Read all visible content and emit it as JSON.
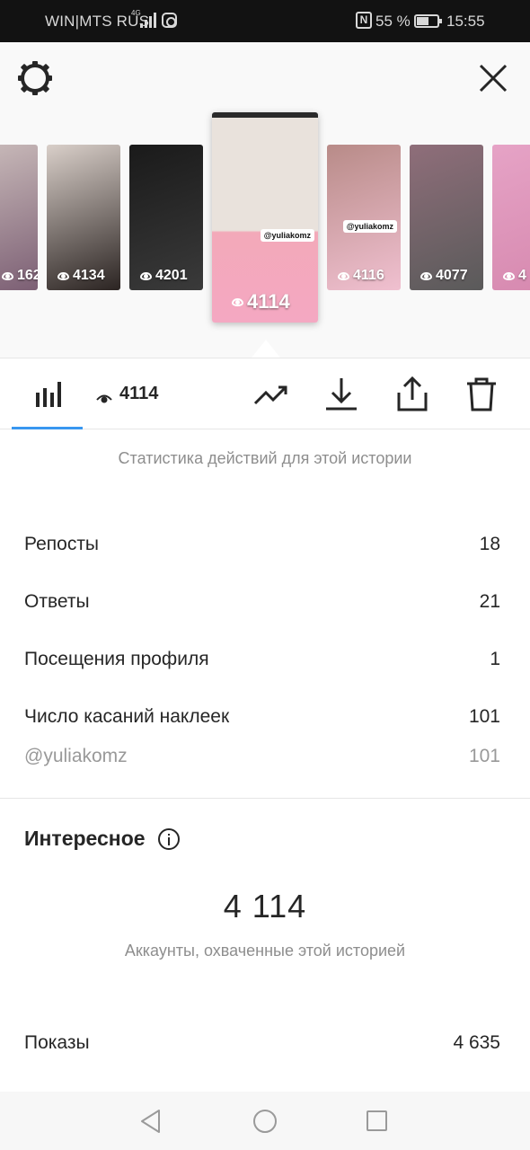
{
  "status_bar": {
    "carrier": "WIN|MTS RUS",
    "network": "4G",
    "battery_percent": "55 %",
    "time": "15:55"
  },
  "stories": [
    {
      "views": "162",
      "colors": [
        "#c7b8b8",
        "#7c5f74"
      ]
    },
    {
      "views": "4134",
      "colors": [
        "#d9cfc9",
        "#2b2422"
      ]
    },
    {
      "views": "4201",
      "colors": [
        "#1a1a1a",
        "#3a3a3a"
      ]
    },
    {
      "views": "4114",
      "tag": "@yuliakomz",
      "selected": true,
      "colors": [
        "#e9e2dc",
        "#f3a9b9",
        "#f4a8c2"
      ]
    },
    {
      "views": "4116",
      "tag": "@yuliakomz",
      "colors": [
        "#b88b88",
        "#f0c0d0"
      ]
    },
    {
      "views": "4077",
      "colors": [
        "#8f6e7a",
        "#5a5a5a"
      ]
    },
    {
      "views": "4",
      "colors": [
        "#e6a3c6",
        "#d78ab0"
      ]
    }
  ],
  "toolbar": {
    "views": "4114"
  },
  "subtitle": "Статистика действий для этой истории",
  "stats": [
    {
      "label": "Репосты",
      "value": "18"
    },
    {
      "label": "Ответы",
      "value": "21"
    },
    {
      "label": "Посещения профиля",
      "value": "1"
    },
    {
      "label": "Число касаний наклеек",
      "value": "101"
    },
    {
      "label": "@yuliakomz",
      "value": "101"
    }
  ],
  "interesting": {
    "title": "Интересное",
    "reach": "4 114",
    "reach_label": "Аккаунты, охваченные этой историей",
    "impressions_label": "Показы",
    "impressions_value": "4 635"
  },
  "colors": {
    "accent": "#3897f0",
    "text": "#262626",
    "secondary": "#8e8e8e"
  }
}
